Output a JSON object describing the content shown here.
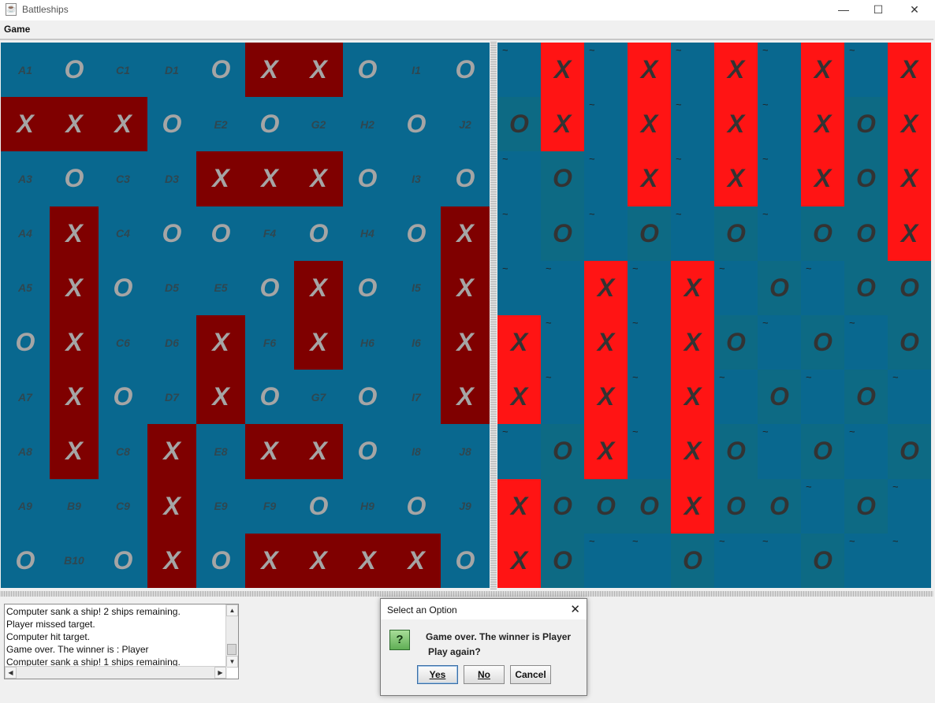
{
  "window": {
    "title": "Battleships",
    "minimize": "—",
    "maximize": "☐",
    "close": "✕",
    "app_icon": "java-cup-icon"
  },
  "menu": {
    "game": "Game"
  },
  "colors": {
    "sea": "#09688f",
    "ship": "#7f0000",
    "hit": "#ff1414",
    "miss": "#0d6a84"
  },
  "player_board": {
    "rows": [
      [
        "A1",
        "O",
        "C1",
        "D1",
        "O",
        "X*",
        "X*",
        "O",
        "I1",
        "O"
      ],
      [
        "X*",
        "X*",
        "X*",
        "O",
        "E2",
        "O",
        "G2",
        "H2",
        "O",
        "J2"
      ],
      [
        "A3",
        "O",
        "C3",
        "D3",
        "X*",
        "X*",
        "X*",
        "O",
        "I3",
        "O"
      ],
      [
        "A4",
        "X*",
        "C4",
        "O",
        "O",
        "F4",
        "O",
        "H4",
        "O",
        "X*"
      ],
      [
        "A5",
        "X*",
        "O",
        "D5",
        "E5",
        "O",
        "X*",
        "O",
        "I5",
        "X*"
      ],
      [
        "O",
        "X*",
        "C6",
        "D6",
        "X*",
        "F6",
        "X*",
        "H6",
        "I6",
        "X*"
      ],
      [
        "A7",
        "X*",
        "O",
        "D7",
        "X*",
        "O",
        "G7",
        "O",
        "I7",
        "X*"
      ],
      [
        "A8",
        "X*",
        "C8",
        "X*",
        "E8",
        "X*",
        "X*",
        "O",
        "I8",
        "J8"
      ],
      [
        "A9",
        "B9",
        "C9",
        "X*",
        "E9",
        "F9",
        "O",
        "H9",
        "O",
        "J9"
      ],
      [
        "O",
        "B10",
        "O",
        "X*",
        "O",
        "X*",
        "X*",
        "X*",
        "X*",
        "O"
      ]
    ]
  },
  "computer_board": {
    "rows": [
      [
        "~",
        "X",
        "~",
        "X",
        "~",
        "X",
        "~",
        "X",
        "~",
        "X"
      ],
      [
        "O",
        "X",
        "~",
        "X",
        "~",
        "X",
        "~",
        "X",
        "O",
        "X"
      ],
      [
        "~",
        "O",
        "~",
        "X",
        "~",
        "X",
        "~",
        "X",
        "O",
        "X"
      ],
      [
        "~",
        "O",
        "~",
        "O",
        "~",
        "O",
        "~",
        "O",
        "O",
        "X"
      ],
      [
        "~",
        "~",
        "X",
        "~",
        "X",
        "~",
        "O",
        "~",
        "O",
        "O"
      ],
      [
        "X",
        "~",
        "X",
        "~",
        "X",
        "O",
        "~",
        "O",
        "~",
        "O"
      ],
      [
        "X",
        "~",
        "X",
        "~",
        "X",
        "~",
        "O",
        "~",
        "O",
        "~"
      ],
      [
        "~",
        "O",
        "X",
        "~",
        "X",
        "O",
        "~",
        "O",
        "~",
        "O"
      ],
      [
        "X",
        "O",
        "O",
        "O",
        "X",
        "O",
        "O",
        "~",
        "O",
        "~"
      ],
      [
        "X",
        "O",
        "~",
        "~",
        "O",
        "~",
        "~",
        "O",
        "~",
        "~"
      ]
    ]
  },
  "log": {
    "lines": [
      "Computer sank a ship! 2 ships remaining.",
      "Player missed target.",
      "Computer hit target.",
      "Game over. The winner is : Player",
      "Computer sank a ship! 1 ships remaining."
    ],
    "scroll_up": "▲",
    "scroll_down": "▼",
    "scroll_left": "◀",
    "scroll_right": "▶"
  },
  "dialog": {
    "title": "Select an Option",
    "close": "✕",
    "icon_glyph": "?",
    "message_line1": "Game over. The winner is Player",
    "message_line2": "Play again?",
    "yes": "Yes",
    "no": "No",
    "cancel": "Cancel"
  }
}
